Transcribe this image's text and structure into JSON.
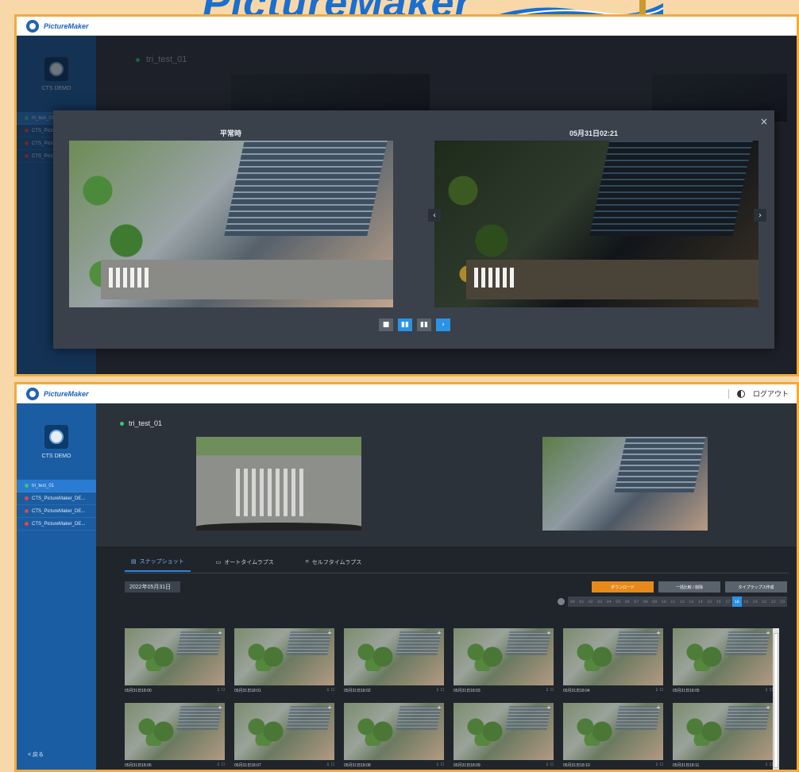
{
  "top_banner": {
    "brand": "PictureMaker"
  },
  "app": {
    "brand": "PictureMaker",
    "theme_label": "",
    "logout_label": "ログアウト"
  },
  "sidebar": {
    "account": "CTS DEMO",
    "items": [
      {
        "label": "tri_test_01",
        "status": "online"
      },
      {
        "label": "CTS_PictureMaker_DE...",
        "status": "offline"
      },
      {
        "label": "CTS_PictureMaker_DE...",
        "status": "offline"
      },
      {
        "label": "CTS_PictureMaker_DE...",
        "status": "offline"
      }
    ],
    "back_label": "< 戻る"
  },
  "top_frame": {
    "camera_name": "tri_test_01",
    "modal": {
      "left_label": "平常時",
      "right_label": "05月31日02:21",
      "close_glyph": "×",
      "prev_glyph": "‹",
      "next_glyph": "›",
      "controls": [
        "■",
        "▮▮",
        "▮▮",
        "›"
      ]
    }
  },
  "bottom_frame": {
    "camera_name": "tri_test_01",
    "tabs": [
      {
        "icon": "▤",
        "label": "スナップショット",
        "active": true
      },
      {
        "icon": "▭",
        "label": "オートタイムラプス",
        "active": false
      },
      {
        "icon": "⌗",
        "label": "セルフタイムラプス",
        "active": false
      }
    ],
    "date": "2022年05月31日",
    "buttons": {
      "download": "ダウンロード",
      "batch": "一括比較 / 削除",
      "filter": "タイプラップス作成"
    },
    "hours": [
      "00",
      "01",
      "02",
      "03",
      "04",
      "05",
      "06",
      "07",
      "08",
      "09",
      "10",
      "11",
      "12",
      "13",
      "14",
      "15",
      "16",
      "17",
      "18",
      "19",
      "20",
      "21",
      "22",
      "23"
    ],
    "selected_hour": "18",
    "snapshots": [
      "05月31日18:00",
      "05月31日18:01",
      "05月31日18:02",
      "05月31日18:03",
      "05月31日18:04",
      "05月31日18:05",
      "05月31日18:06",
      "05月31日18:07",
      "05月31日18:08",
      "05月31日18:09",
      "05月31日18:10",
      "05月31日18:11"
    ]
  }
}
